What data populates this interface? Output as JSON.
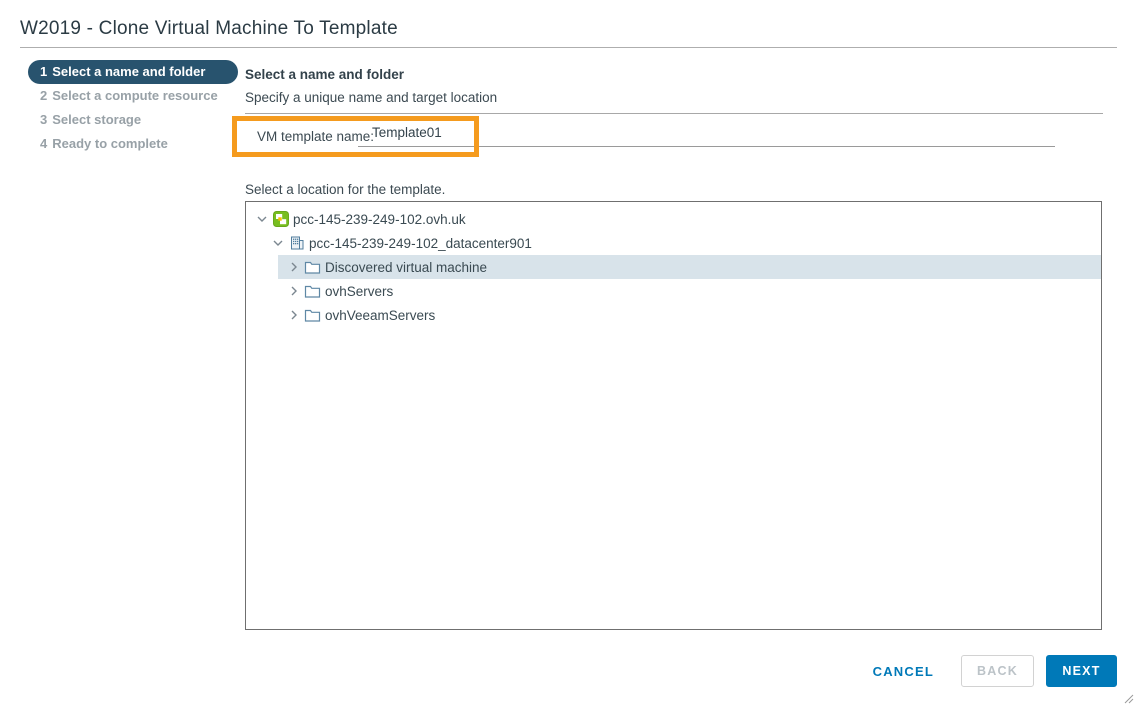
{
  "window": {
    "title": "W2019 - Clone Virtual Machine To Template"
  },
  "steps": [
    {
      "number": "1",
      "label": "Select a name and folder",
      "state": "active"
    },
    {
      "number": "2",
      "label": "Select a compute resource",
      "state": "upcoming"
    },
    {
      "number": "3",
      "label": "Select storage",
      "state": "upcoming"
    },
    {
      "number": "4",
      "label": "Ready to complete",
      "state": "upcoming"
    }
  ],
  "content": {
    "heading": "Select a name and folder",
    "subheading": "Specify a unique name and target location",
    "name_label": "VM template name:",
    "name_value": "Template01",
    "location_caption": "Select a location for the template."
  },
  "tree": {
    "items": [
      {
        "label": "pcc-145-239-249-102.ovh.uk",
        "icon": "vcenter-icon",
        "level": 0,
        "expanded": true,
        "selected": false
      },
      {
        "label": "pcc-145-239-249-102_datacenter901",
        "icon": "datacenter-icon",
        "level": 1,
        "expanded": true,
        "selected": false
      },
      {
        "label": "Discovered virtual machine",
        "icon": "folder-icon",
        "level": 2,
        "expanded": false,
        "selected": true
      },
      {
        "label": "ovhServers",
        "icon": "folder-icon",
        "level": 2,
        "expanded": false,
        "selected": false
      },
      {
        "label": "ovhVeeamServers",
        "icon": "folder-icon",
        "level": 2,
        "expanded": false,
        "selected": false
      }
    ]
  },
  "footer": {
    "cancel_label": "CANCEL",
    "back_label": "BACK",
    "next_label": "NEXT"
  },
  "colors": {
    "accent_blue": "#0079b8",
    "active_step_bg": "#28536e",
    "annotation_orange": "#f59b1e",
    "selected_row_bg": "#d8e3ea",
    "vcenter_green": "#78be20",
    "icon_steel_blue": "#517e9e"
  }
}
